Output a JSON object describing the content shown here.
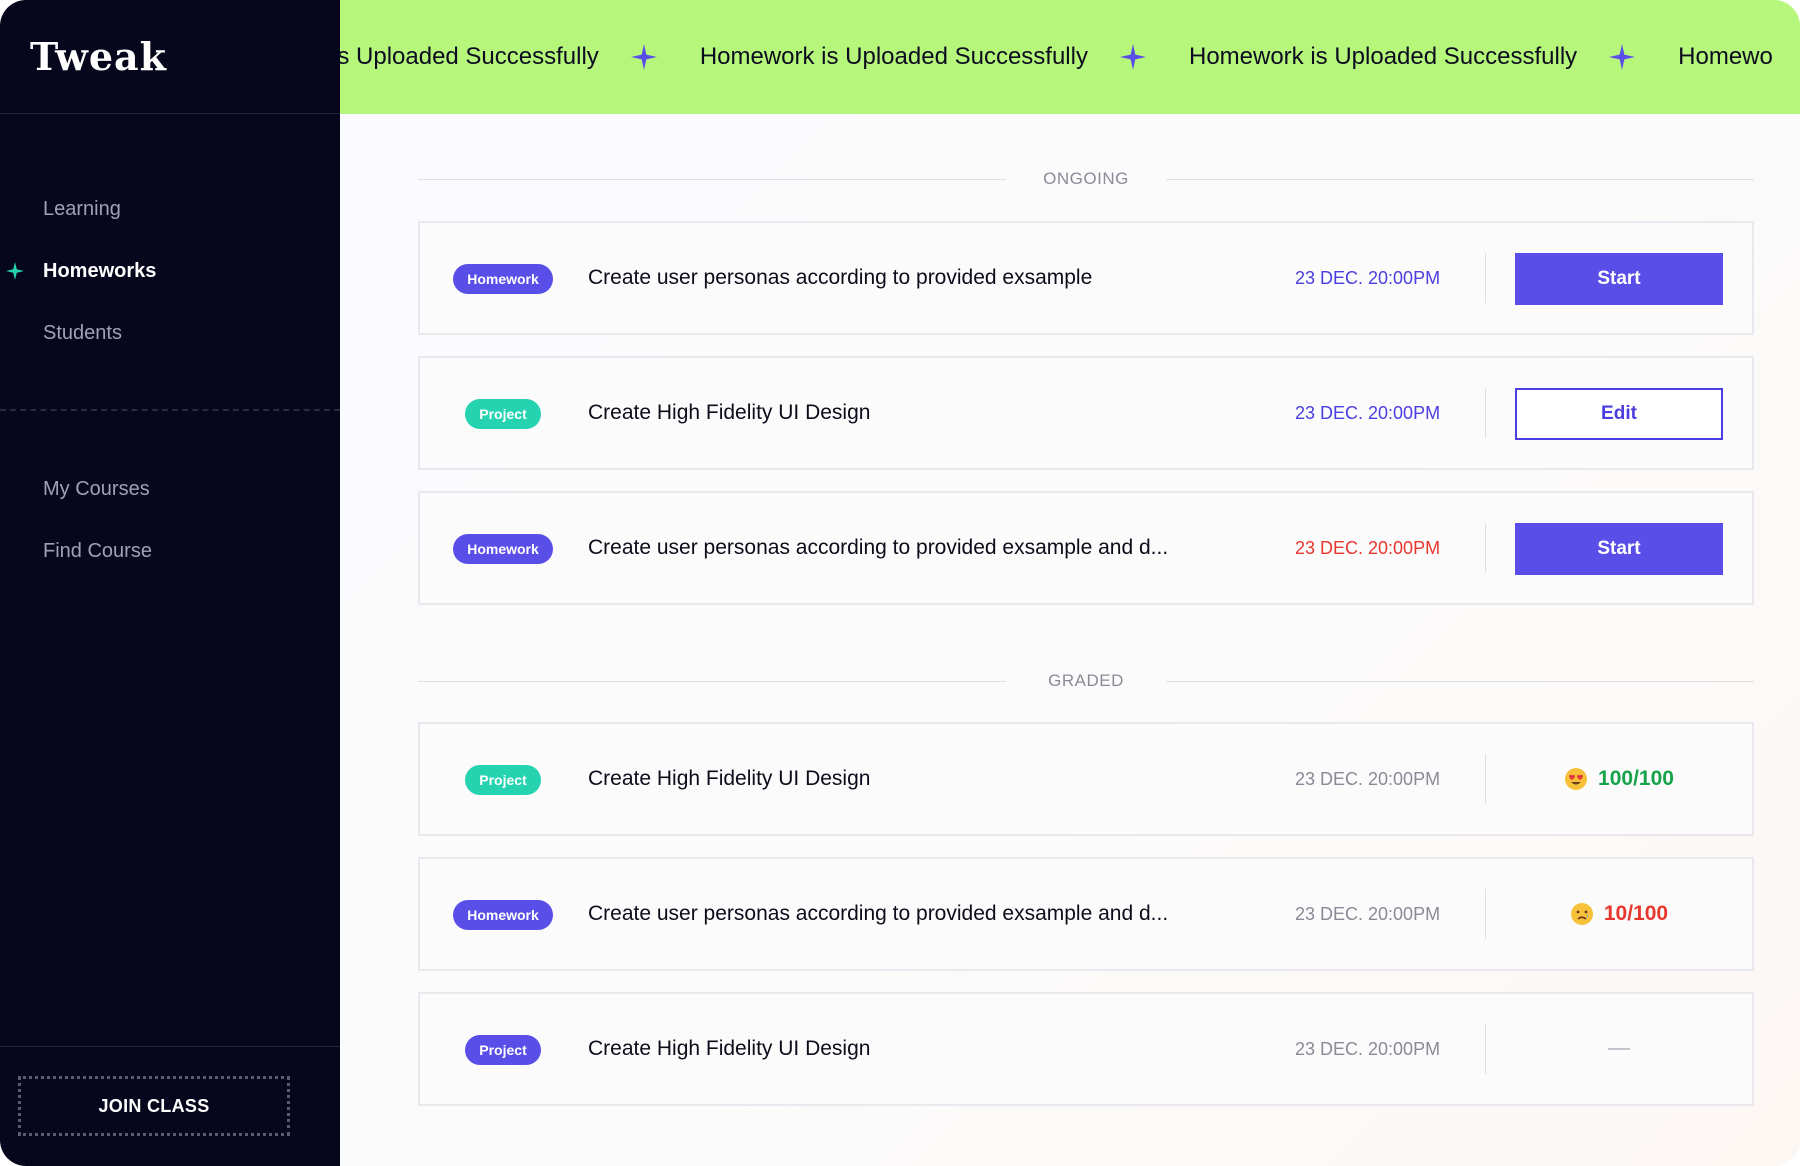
{
  "app": {
    "logo": "Tweak"
  },
  "sidebar": {
    "primary_items": [
      {
        "label": "Learning",
        "active": false
      },
      {
        "label": "Homeworks",
        "active": true
      },
      {
        "label": "Students",
        "active": false
      }
    ],
    "secondary_items": [
      {
        "label": "My Courses"
      },
      {
        "label": "Find Course"
      }
    ],
    "join_button": "JOIN CLASS"
  },
  "banner": {
    "messages": [
      "ork is Uploaded Successfully",
      "Homework is Uploaded Successfully",
      "Homework is Uploaded Successfully",
      "Homewo"
    ],
    "color": "#b6f67a"
  },
  "sections": {
    "ongoing": "ONGOING",
    "graded": "GRADED"
  },
  "ongoing": [
    {
      "tag": "Homework",
      "title": "Create user personas according to provided exsample",
      "date": "23 DEC. 20:00PM",
      "action": "Start"
    },
    {
      "tag": "Project",
      "title": "Create High Fidelity UI Design",
      "date": "23 DEC. 20:00PM",
      "action": "Edit"
    },
    {
      "tag": "Homework",
      "title": "Create user personas according to provided exsample and d...",
      "date": "23 DEC. 20:00PM",
      "action": "Start"
    }
  ],
  "graded": [
    {
      "tag": "Project",
      "title": "Create High Fidelity UI Design",
      "date": "23 DEC. 20:00PM",
      "score": "100/100",
      "emoji": "heart-eyes-emoji"
    },
    {
      "tag": "Homework",
      "title": "Create user personas according to provided exsample and d...",
      "date": "23 DEC. 20:00PM",
      "score": "10/100",
      "emoji": "sad-emoji"
    },
    {
      "tag": "Project",
      "title": "Create High Fidelity UI Design",
      "date": "23 DEC. 20:00PM",
      "score": "—"
    }
  ],
  "colors": {
    "accent": "#5a4ee8",
    "teal": "#25d3b0",
    "overdue": "#e8372d",
    "success": "#16a34a",
    "sidebar_bg": "#06061c"
  }
}
